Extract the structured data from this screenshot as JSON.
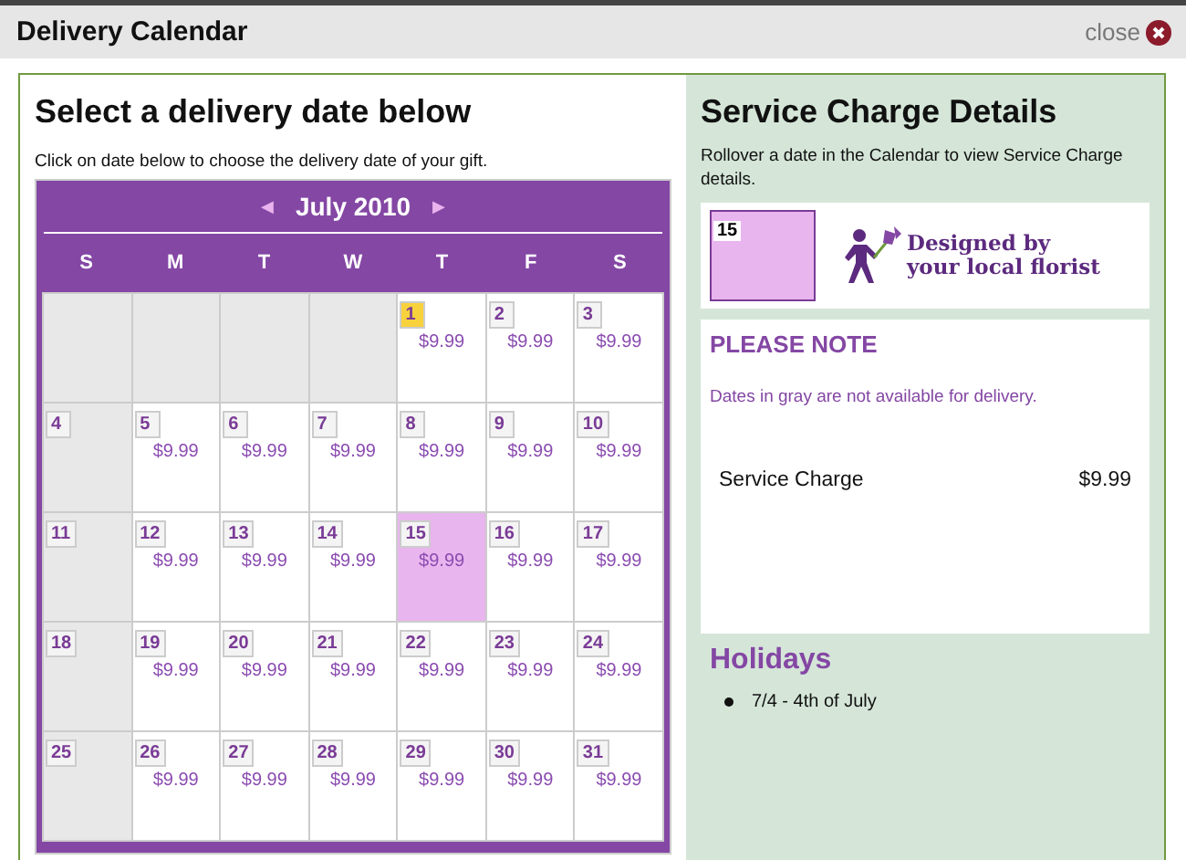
{
  "window": {
    "title": "Delivery Calendar",
    "close_label": "close"
  },
  "calendar_panel": {
    "heading": "Select a delivery date below",
    "instruction": "Click on date below to choose the delivery date of your gift.",
    "prev": "◀",
    "next": "▶",
    "month": "July 2010",
    "weekdays": [
      "S",
      "M",
      "T",
      "W",
      "T",
      "F",
      "S"
    ],
    "weeks": [
      [
        {
          "kind": "blank"
        },
        {
          "kind": "blank"
        },
        {
          "kind": "blank"
        },
        {
          "kind": "blank"
        },
        {
          "kind": "date",
          "day": "1",
          "price": "$9.99",
          "available": true,
          "today": true,
          "selected": false
        },
        {
          "kind": "date",
          "day": "2",
          "price": "$9.99",
          "available": true,
          "today": false,
          "selected": false
        },
        {
          "kind": "date",
          "day": "3",
          "price": "$9.99",
          "available": true,
          "today": false,
          "selected": false
        }
      ],
      [
        {
          "kind": "date",
          "day": "4",
          "available": false,
          "today": false,
          "selected": false
        },
        {
          "kind": "date",
          "day": "5",
          "price": "$9.99",
          "available": true,
          "today": false,
          "selected": false
        },
        {
          "kind": "date",
          "day": "6",
          "price": "$9.99",
          "available": true,
          "today": false,
          "selected": false
        },
        {
          "kind": "date",
          "day": "7",
          "price": "$9.99",
          "available": true,
          "today": false,
          "selected": false
        },
        {
          "kind": "date",
          "day": "8",
          "price": "$9.99",
          "available": true,
          "today": false,
          "selected": false
        },
        {
          "kind": "date",
          "day": "9",
          "price": "$9.99",
          "available": true,
          "today": false,
          "selected": false
        },
        {
          "kind": "date",
          "day": "10",
          "price": "$9.99",
          "available": true,
          "today": false,
          "selected": false
        }
      ],
      [
        {
          "kind": "date",
          "day": "11",
          "available": false,
          "today": false,
          "selected": false
        },
        {
          "kind": "date",
          "day": "12",
          "price": "$9.99",
          "available": true,
          "today": false,
          "selected": false
        },
        {
          "kind": "date",
          "day": "13",
          "price": "$9.99",
          "available": true,
          "today": false,
          "selected": false
        },
        {
          "kind": "date",
          "day": "14",
          "price": "$9.99",
          "available": true,
          "today": false,
          "selected": false
        },
        {
          "kind": "date",
          "day": "15",
          "price": "$9.99",
          "available": true,
          "today": false,
          "selected": true
        },
        {
          "kind": "date",
          "day": "16",
          "price": "$9.99",
          "available": true,
          "today": false,
          "selected": false
        },
        {
          "kind": "date",
          "day": "17",
          "price": "$9.99",
          "available": true,
          "today": false,
          "selected": false
        }
      ],
      [
        {
          "kind": "date",
          "day": "18",
          "available": false,
          "today": false,
          "selected": false
        },
        {
          "kind": "date",
          "day": "19",
          "price": "$9.99",
          "available": true,
          "today": false,
          "selected": false
        },
        {
          "kind": "date",
          "day": "20",
          "price": "$9.99",
          "available": true,
          "today": false,
          "selected": false
        },
        {
          "kind": "date",
          "day": "21",
          "price": "$9.99",
          "available": true,
          "today": false,
          "selected": false
        },
        {
          "kind": "date",
          "day": "22",
          "price": "$9.99",
          "available": true,
          "today": false,
          "selected": false
        },
        {
          "kind": "date",
          "day": "23",
          "price": "$9.99",
          "available": true,
          "today": false,
          "selected": false
        },
        {
          "kind": "date",
          "day": "24",
          "price": "$9.99",
          "available": true,
          "today": false,
          "selected": false
        }
      ],
      [
        {
          "kind": "date",
          "day": "25",
          "available": false,
          "today": false,
          "selected": false
        },
        {
          "kind": "date",
          "day": "26",
          "price": "$9.99",
          "available": true,
          "today": false,
          "selected": false
        },
        {
          "kind": "date",
          "day": "27",
          "price": "$9.99",
          "available": true,
          "today": false,
          "selected": false
        },
        {
          "kind": "date",
          "day": "28",
          "price": "$9.99",
          "available": true,
          "today": false,
          "selected": false
        },
        {
          "kind": "date",
          "day": "29",
          "price": "$9.99",
          "available": true,
          "today": false,
          "selected": false
        },
        {
          "kind": "date",
          "day": "30",
          "price": "$9.99",
          "available": true,
          "today": false,
          "selected": false
        },
        {
          "kind": "date",
          "day": "31",
          "price": "$9.99",
          "available": true,
          "today": false,
          "selected": false
        }
      ]
    ]
  },
  "details_panel": {
    "heading": "Service Charge Details",
    "instruction": "Rollover a date in the Calendar to view Service Charge details.",
    "preview_day": "15",
    "logo_text": "Designed by your local florist",
    "note_title": "PLEASE NOTE",
    "note_text": "Dates in gray are not available for delivery.",
    "charge_label": "Service Charge",
    "charge_value": "$9.99",
    "holidays_title": "Holidays",
    "holidays": [
      "7/4 - 4th of July"
    ]
  }
}
